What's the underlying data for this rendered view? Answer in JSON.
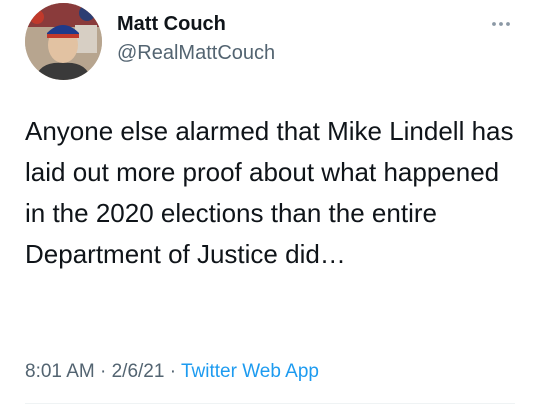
{
  "author": {
    "display_name": "Matt Couch",
    "handle": "@RealMattCouch"
  },
  "tweet": {
    "text": "Anyone else alarmed that Mike Lindell has laid out more proof about what happened in the 2020 elections than the entire Department of Justice did…",
    "time": "8:01 AM",
    "separator": " · ",
    "date": "2/6/21",
    "source": "Twitter Web App"
  },
  "icons": {
    "more": "more-horizontal-icon"
  },
  "colors": {
    "text": "#0f1419",
    "secondary": "#536471",
    "link": "#1d9bf0"
  }
}
